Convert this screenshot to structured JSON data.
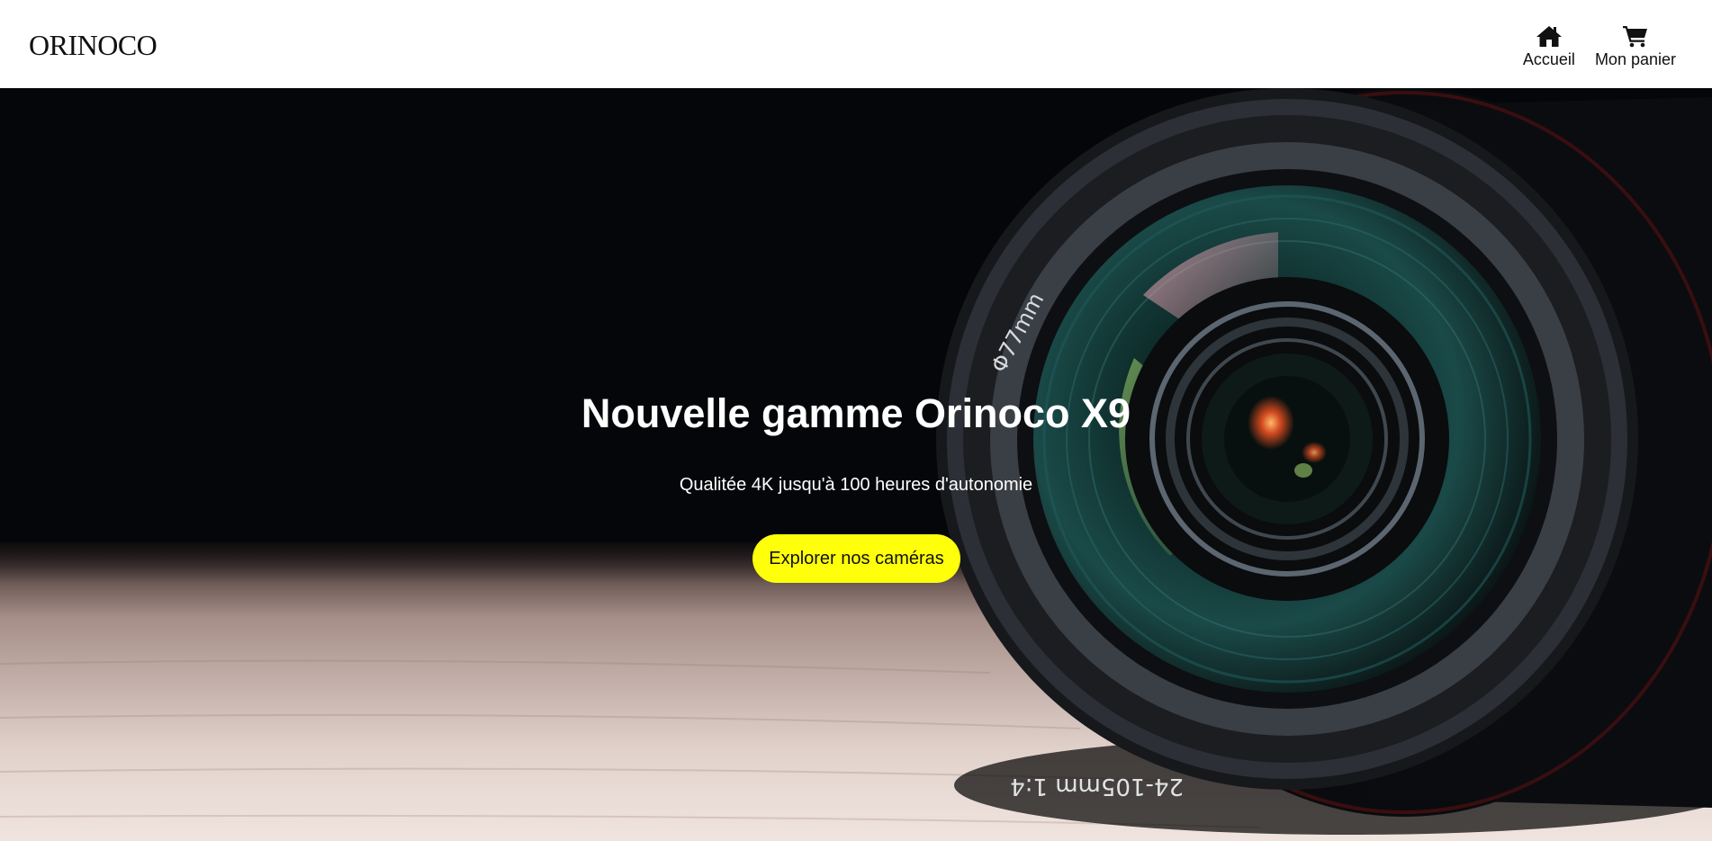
{
  "header": {
    "logo_text": "ORINOCO",
    "nav": [
      {
        "label": "Accueil",
        "icon": "home-icon"
      },
      {
        "label": "Mon panier",
        "icon": "cart-icon"
      }
    ]
  },
  "hero": {
    "title": "Nouvelle gamme Orinoco X9",
    "subtitle": "Qualitée 4K jusqu'à 100 heures d'autonomie",
    "cta_label": "Explorer nos caméras",
    "lens_marking_top": "Φ77mm",
    "lens_marking_bottom": "24-105mm 1:4"
  },
  "colors": {
    "cta_background": "#ffff0a",
    "hero_background": "#05060a",
    "header_background": "#ffffff",
    "text_light": "#ffffff",
    "text_dark": "#111111"
  }
}
